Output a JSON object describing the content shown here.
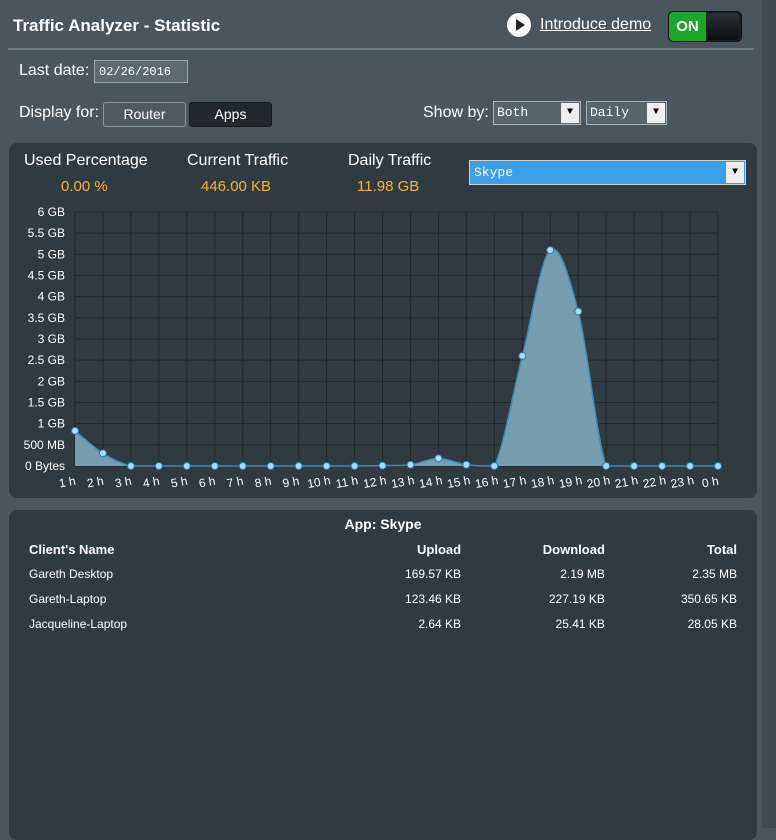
{
  "header": {
    "title": "Traffic Analyzer - Statistic",
    "intro_link": "Introduce demo",
    "toggle_label": "ON"
  },
  "controls": {
    "last_date_label": "Last date:",
    "last_date_value": "02/26/2016",
    "display_for_label": "Display for:",
    "router_button": "Router",
    "apps_button": "Apps",
    "show_by_label": "Show by:",
    "show_by_selected": "Both",
    "period_selected": "Daily"
  },
  "stats": {
    "used_percentage_label": "Used Percentage",
    "used_percentage_value": "0.00 %",
    "current_traffic_label": "Current Traffic",
    "current_traffic_value": "446.00 KB",
    "daily_traffic_label": "Daily Traffic",
    "daily_traffic_value": "11.98 GB",
    "app_selected": "Skype"
  },
  "colors": {
    "accent_yellow": "#f3b431",
    "area_fill": "#7fa9bd",
    "point_color": "#a8dcf5",
    "select_blue": "#3d9ee8",
    "toggle_green": "#1ea52c"
  },
  "chart_data": {
    "type": "area",
    "x": [
      "1 h",
      "2 h",
      "3 h",
      "4 h",
      "5 h",
      "6 h",
      "7 h",
      "8 h",
      "9 h",
      "10 h",
      "11 h",
      "12 h",
      "13 h",
      "14 h",
      "15 h",
      "16 h",
      "17 h",
      "18 h",
      "19 h",
      "20 h",
      "21 h",
      "22 h",
      "23 h",
      "0 h"
    ],
    "y_gb": [
      0.83,
      0.3,
      0,
      0,
      0,
      0,
      0,
      0,
      0,
      0,
      0,
      0.01,
      0.03,
      0.18,
      0.03,
      0,
      2.6,
      5.1,
      3.65,
      0,
      0,
      0,
      0,
      0
    ],
    "y_ticks": [
      "0 Bytes",
      "500 MB",
      "1 GB",
      "1.5 GB",
      "2 GB",
      "2.5 GB",
      "3 GB",
      "3.5 GB",
      "4 GB",
      "4.5 GB",
      "5 GB",
      "5.5 GB",
      "6 GB"
    ],
    "ylim": [
      0,
      6
    ],
    "grid": true
  },
  "clients": {
    "title": "App: Skype",
    "columns": [
      "Client's Name",
      "Upload",
      "Download",
      "Total"
    ],
    "rows": [
      [
        "Gareth Desktop",
        "169.57 KB",
        "2.19 MB",
        "2.35 MB"
      ],
      [
        "Gareth-Laptop",
        "123.46 KB",
        "227.19 KB",
        "350.65 KB"
      ],
      [
        "Jacqueline-Laptop",
        "2.64 KB",
        "25.41 KB",
        "28.05 KB"
      ]
    ]
  }
}
